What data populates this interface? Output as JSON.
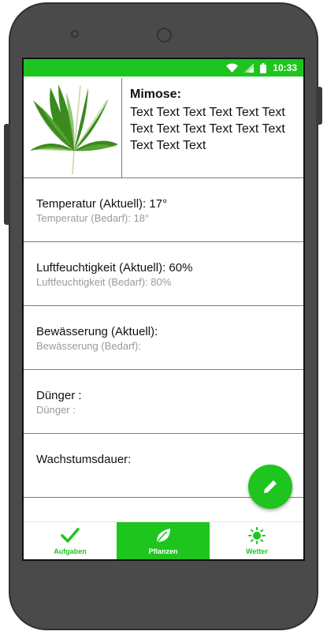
{
  "colors": {
    "accent": "#1ec51e",
    "divider": "#7c7c7c",
    "secondary_text": "#9a9a9a"
  },
  "statusbar": {
    "time": "10:33",
    "icons": [
      "wifi-icon",
      "signal-icon",
      "battery-icon"
    ]
  },
  "plant": {
    "name": "Mimose:",
    "description": "Text Text Text Text Text Text Text Text Text Text Text Text Text Text Text",
    "image_icon": "mimosa-leaf-image"
  },
  "rows": [
    {
      "main": "Temperatur (Aktuell): 17°",
      "sub": "Temperatur (Bedarf): 18°"
    },
    {
      "main": "Luftfeuchtigkeit (Aktuell): 60%",
      "sub": "Luftfeuchtigkeit (Bedarf): 80%"
    },
    {
      "main": "Bewässerung (Aktuell):",
      "sub": "Bewässerung (Bedarf):"
    },
    {
      "main": "Dünger :",
      "sub": "Dünger :"
    },
    {
      "main": "Wachstumsdauer:",
      "sub": ""
    }
  ],
  "fab": {
    "icon": "pencil-icon"
  },
  "nav": [
    {
      "label": "Aufgaben",
      "icon": "checkmark-icon",
      "active": false
    },
    {
      "label": "Pflanzen",
      "icon": "leaf-icon",
      "active": true
    },
    {
      "label": "Wetter",
      "icon": "sun-icon",
      "active": false
    }
  ]
}
